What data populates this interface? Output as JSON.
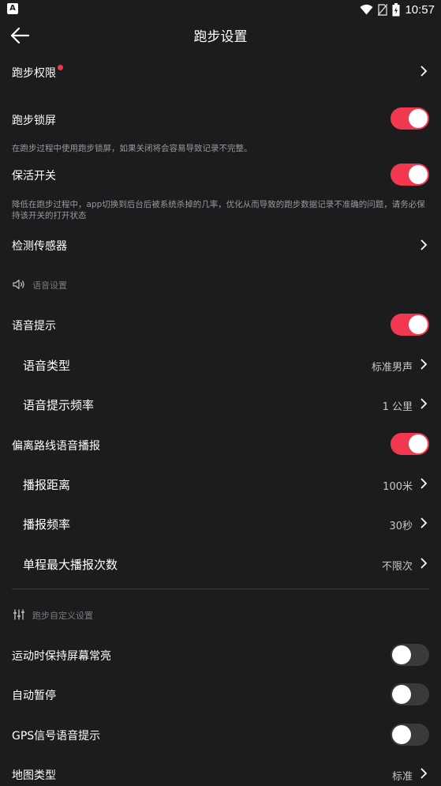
{
  "status_bar": {
    "app_icon": "A",
    "time": "10:57",
    "icons": [
      "wifi-icon",
      "no-sim-icon",
      "battery-icon"
    ]
  },
  "header": {
    "back_icon": "arrow-left-icon",
    "title": "跑步设置"
  },
  "rows": {
    "run_permission": {
      "label": "跑步权限",
      "badge": "red-dot"
    },
    "run_lockscreen": {
      "label": "跑步锁屏",
      "on": true,
      "hint": "在跑步过程中使用跑步锁屏，如果关闭将会容易导致记录不完整。"
    },
    "keep_alive": {
      "label": "保活开关",
      "on": true,
      "hint": "降低在跑步过程中，app切换到后台后被系统杀掉的几率，优化从而导致的跑步数据记录不准确的问题，请务必保持该开关的打开状态"
    },
    "sensor_check": {
      "label": "检测传感器"
    },
    "voice_prompt": {
      "label": "语音提示",
      "on": true
    },
    "voice_type": {
      "label": "语音类型",
      "value": "标准男声"
    },
    "voice_freq": {
      "label": "语音提示频率",
      "value": "1 公里"
    },
    "off_route_voice": {
      "label": "偏离路线语音播报",
      "on": true
    },
    "broadcast_distance": {
      "label": "播报距离",
      "value": "100米"
    },
    "broadcast_freq": {
      "label": "播报频率",
      "value": "30秒"
    },
    "max_broadcasts": {
      "label": "单程最大播报次数",
      "value": "不限次"
    },
    "keep_screen_on": {
      "label": "运动时保持屏幕常亮",
      "on": false
    },
    "auto_pause": {
      "label": "自动暂停",
      "on": false
    },
    "gps_voice": {
      "label": "GPS信号语音提示",
      "on": false
    },
    "map_type": {
      "label": "地图类型",
      "value": "标准"
    }
  },
  "sections": {
    "voice_settings": {
      "label": "语音设置",
      "icon": "speaker-icon"
    },
    "custom_settings": {
      "label": "跑步自定义设置",
      "icon": "sliders-icon"
    }
  },
  "colors": {
    "background": "#1c1c1e",
    "accent": "#f23850",
    "toggle_off": "#3a3a3c",
    "secondary_text": "#c6c6c8",
    "hint_text": "#9a9a9e"
  }
}
